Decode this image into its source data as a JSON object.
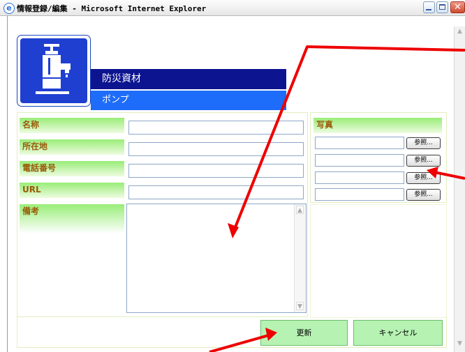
{
  "window": {
    "title": "情報登録/編集 - Microsoft Internet Explorer",
    "app_icon": "ie-icon",
    "close_glyph": "✕"
  },
  "category": {
    "main": "防災資材",
    "sub": "ポンプ",
    "logo_icon": "faucet-icon"
  },
  "form": {
    "fields": [
      {
        "label": "名称",
        "value": ""
      },
      {
        "label": "所在地",
        "value": ""
      },
      {
        "label": "電話番号",
        "value": ""
      },
      {
        "label": "URL",
        "value": ""
      }
    ],
    "notes_label": "備考",
    "notes_value": ""
  },
  "photos": {
    "header": "写真",
    "browse_label": "参照...",
    "count": 4
  },
  "actions": {
    "update": "更新",
    "cancel": "キャンセル"
  },
  "colors": {
    "annotation_arrow": "#ee0000",
    "category_main_bg": "#0c1490",
    "category_sub_bg": "#1e6cfa",
    "label_green": "#98ed77",
    "label_text": "#9a5a08",
    "button_green": "#b6f3b3"
  }
}
